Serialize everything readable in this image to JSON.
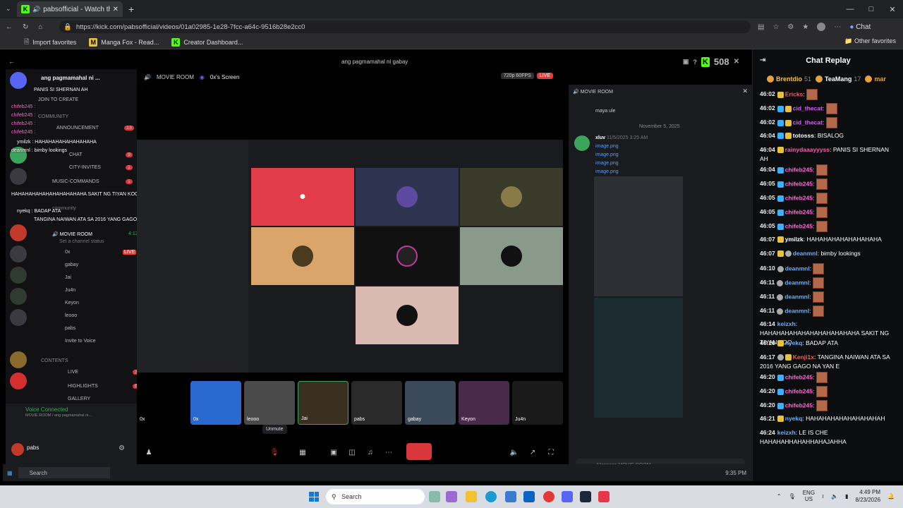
{
  "browser": {
    "tab_title": "pabsofficial - Watch the VOD",
    "url": "https://kick.com/pabsofficial/videos/01a02985-1e28-7fcc-a64c-9516b28e2cc0",
    "bookmarks": [
      "Import favorites",
      "Manga Fox - Read...",
      "Creator Dashboard..."
    ],
    "other_favorites": "Other favorites",
    "chat_button": "Chat"
  },
  "video": {
    "title": "ang pagmamahal ni gabay",
    "viewers": "508"
  },
  "discord": {
    "server_name": "ang pagmamahal ni ...",
    "stream_channel": "MOVIE ROOM",
    "stream_source": "0x's Screen",
    "stream_quality": "720p 60FPS",
    "live_label": "LIVE",
    "channels": [
      {
        "label": "JOIN TO CREATE",
        "badge": ""
      },
      {
        "label": "COMMUNITY",
        "badge": ""
      },
      {
        "label": "ANNOUNCEMENT",
        "badge": "13"
      },
      {
        "label": "CHAT",
        "badge": "9"
      },
      {
        "label": "CITY-INVITES",
        "badge": "1"
      },
      {
        "label": "MUSIC-COMMANDS",
        "badge": "1"
      },
      {
        "label": "community",
        "badge": ""
      },
      {
        "label": "MOVIE ROOM",
        "badge": "4:13"
      },
      {
        "label": "Set a channel status",
        "badge": ""
      }
    ],
    "voice_users": [
      "0x",
      "gabay",
      "Jai",
      "Ju4n",
      "Keyon",
      "leooo",
      "pabs"
    ],
    "invite": "Invite to Voice",
    "sections": [
      {
        "label": "CONTENTS",
        "badge": ""
      },
      {
        "label": "LIVE",
        "badge": "377"
      },
      {
        "label": "HIGHLIGHTS",
        "badge": "69"
      },
      {
        "label": "GALLERY",
        "badge": ""
      }
    ],
    "voice_connected": "Voice Connected",
    "voice_sub": "MOVIE ROOM / ang pagmamahal ni...",
    "user_name": "pabs",
    "tooltip": "Unmute",
    "overlay_chat": [
      "PANIS SI SHERNAN AH",
      "chifeb245 :",
      "chifeb245 :",
      "chifeb245 :",
      "chifeb245 :",
      "ymilzk : HAHAHAHAHAHAHAHAHA",
      "deanmnl : bimby lookings",
      "HAHAHAHAHAHAHAHAHAHAHA SAKIT NG TIYAN KOO",
      "nyekq : BADAP ATA",
      "TANGINA NAIWAN ATA SA 2016 YANG GAGO NA"
    ],
    "thumbs": [
      "0x",
      "0x",
      "leooo",
      "Jai",
      "pabs",
      "gabay",
      "Keyon",
      "Ju4n"
    ],
    "right_channel": "MOVIE ROOM",
    "right_messages": [
      {
        "user": "",
        "text": "maya ule"
      },
      {
        "user": "",
        "text": "November 5, 2025"
      },
      {
        "user": "xluv",
        "text": "11/5/2025 3:25 AM"
      },
      {
        "user": "",
        "text": "image.png"
      },
      {
        "user": "",
        "text": "image.png"
      },
      {
        "user": "",
        "text": "image.png"
      },
      {
        "user": "",
        "text": "image.png"
      }
    ],
    "message_placeholder": "Message MOVIE ROOM",
    "screen_taskbar_search": "Search",
    "screen_time": "9:35 PM"
  },
  "replay": {
    "title": "Chat Replay",
    "gifters": [
      {
        "name": "Brentdio",
        "count": "51",
        "color": "#f5c542"
      },
      {
        "name": "TeaMang",
        "count": "17",
        "color": "#ffffff"
      },
      {
        "name": "mar",
        "count": "",
        "color": "#e6a23c"
      }
    ],
    "messages": [
      {
        "time": "46:02",
        "badges": [
          "b2"
        ],
        "user": "Ericks",
        "ucolor": "#ff5b5b",
        "text": "",
        "emote": true
      },
      {
        "time": "46:02",
        "badges": [
          "b1",
          "b2"
        ],
        "user": "cid_thecat",
        "ucolor": "#e05cff",
        "text": "",
        "emote": true
      },
      {
        "time": "46:02",
        "badges": [
          "b1",
          "b2"
        ],
        "user": "cid_thecat",
        "ucolor": "#e05cff",
        "text": "",
        "emote": true
      },
      {
        "time": "46:04",
        "badges": [
          "b1",
          "b2"
        ],
        "user": "totosss",
        "ucolor": "#ffffff",
        "text": "BISALOG",
        "emote": false
      },
      {
        "time": "46:04",
        "badges": [
          "b2"
        ],
        "user": "rainydaaayyyss",
        "ucolor": "#ff5bb0",
        "text": "PANIS SI SHERNAN AH",
        "emote": false
      },
      {
        "time": "46:04",
        "badges": [
          "b1"
        ],
        "user": "chifeb245",
        "ucolor": "#ff6bd6",
        "text": "",
        "emote": true
      },
      {
        "time": "46:05",
        "badges": [
          "b1"
        ],
        "user": "chifeb245",
        "ucolor": "#ff6bd6",
        "text": "",
        "emote": true
      },
      {
        "time": "46:05",
        "badges": [
          "b1"
        ],
        "user": "chifeb245",
        "ucolor": "#ff6bd6",
        "text": "",
        "emote": true
      },
      {
        "time": "46:05",
        "badges": [
          "b1"
        ],
        "user": "chifeb245",
        "ucolor": "#ff6bd6",
        "text": "",
        "emote": true
      },
      {
        "time": "46:05",
        "badges": [
          "b1"
        ],
        "user": "chifeb245",
        "ucolor": "#ff6bd6",
        "text": "",
        "emote": true
      },
      {
        "time": "46:07",
        "badges": [
          "b2"
        ],
        "user": "ymilzk",
        "ucolor": "#ffffff",
        "text": "HAHAHAHAHAHAHAHAHA",
        "emote": false
      },
      {
        "time": "46:07",
        "badges": [
          "b2",
          "b3"
        ],
        "user": "deanmnl",
        "ucolor": "#6ab0ff",
        "text": "bimby lookings",
        "emote": false
      },
      {
        "time": "46:10",
        "badges": [
          "b3"
        ],
        "user": "deanmnl",
        "ucolor": "#6ab0ff",
        "text": "",
        "emote": true
      },
      {
        "time": "46:11",
        "badges": [
          "b3"
        ],
        "user": "deanmnl",
        "ucolor": "#6ab0ff",
        "text": "",
        "emote": true
      },
      {
        "time": "46:11",
        "badges": [
          "b3"
        ],
        "user": "deanmnl",
        "ucolor": "#6ab0ff",
        "text": "",
        "emote": true
      },
      {
        "time": "46:11",
        "badges": [
          "b3"
        ],
        "user": "deanmnl",
        "ucolor": "#6ab0ff",
        "text": "",
        "emote": true
      },
      {
        "time": "46:14",
        "badges": [],
        "user": "keizxh",
        "ucolor": "#6ab0ff",
        "text": "HAHAHAHAHAHAHAHAHAHAHAHA SAKIT NG TIYAN KOO",
        "emote": false
      },
      {
        "time": "46:16",
        "badges": [
          "b2"
        ],
        "user": "nyekq",
        "ucolor": "#6ab0ff",
        "text": "BADAP ATA",
        "emote": false
      },
      {
        "time": "46:17",
        "badges": [
          "b3",
          "b2"
        ],
        "user": "Kenji1x",
        "ucolor": "#ff5b5b",
        "text": "TANGINA NAIWAN ATA SA 2016 YANG GAGO NA YAN E",
        "emote": false
      },
      {
        "time": "46:20",
        "badges": [
          "b1"
        ],
        "user": "chifeb245",
        "ucolor": "#ff6bd6",
        "text": "",
        "emote": true
      },
      {
        "time": "46:20",
        "badges": [
          "b1"
        ],
        "user": "chifeb245",
        "ucolor": "#ff6bd6",
        "text": "",
        "emote": true
      },
      {
        "time": "46:20",
        "badges": [
          "b1"
        ],
        "user": "chifeb245",
        "ucolor": "#ff6bd6",
        "text": "",
        "emote": true
      },
      {
        "time": "46:21",
        "badges": [
          "b2"
        ],
        "user": "nyekq",
        "ucolor": "#6ab0ff",
        "text": "HAHAHAHAHAHAHAHAHAH",
        "emote": false
      },
      {
        "time": "46:24",
        "badges": [],
        "user": "keizxh",
        "ucolor": "#6ab0ff",
        "text": "LE IS CHE HAHAHAHHAHAHHAHAJAHHA",
        "emote": false
      }
    ]
  },
  "taskbar": {
    "search": "Search",
    "lang": "ENG",
    "region": "US",
    "time": "4:49 PM",
    "date": "8/23/2026"
  }
}
